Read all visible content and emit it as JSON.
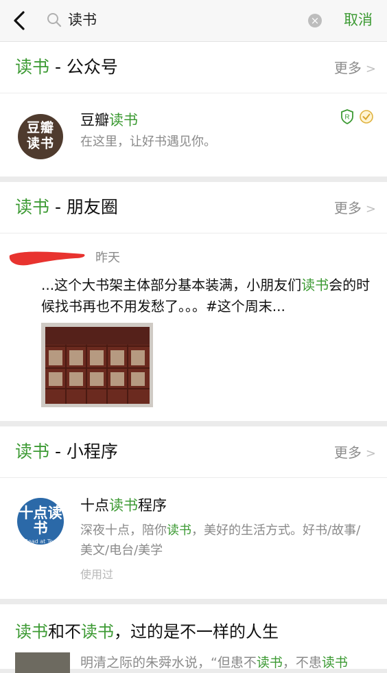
{
  "search": {
    "query": "读书",
    "cancel_label": "取消"
  },
  "sections": {
    "official": {
      "title_hl": "读书",
      "title_rest": " - 公众号",
      "more_label": "更多",
      "account": {
        "avatar_line1": "豆瓣",
        "avatar_line2": "读书",
        "name_pre": "豆瓣",
        "name_hl": "读书",
        "description": "在这里，让好书遇见你。"
      }
    },
    "moments": {
      "title_hl": "读书",
      "title_rest": " - 朋友圈",
      "more_label": "更多",
      "post": {
        "date": "昨天",
        "text_pre": "...这个大书架主体部分基本装满，小朋友们",
        "text_hl": "读书",
        "text_post": "会的时候找书再也不用发愁了。。。#这个周末..."
      }
    },
    "miniprogram": {
      "title_hl": "读书",
      "title_rest": " - 小程序",
      "more_label": "更多",
      "app": {
        "icon_text": "十点读书",
        "icon_sub": "Read at Ten",
        "name_pre": "十点",
        "name_hl": "读书",
        "name_post": "程序",
        "desc_pre": "深夜十点，陪你",
        "desc_hl": "读书",
        "desc_post": "，美好的生活方式。好书/故事/美文/电台/美学",
        "used_label": "使用过"
      }
    },
    "article": {
      "t1": "读书",
      "t2": "和不",
      "t3": "读书",
      "t4": "，过的是不一样的人生",
      "s1": "明清之际的朱舜水说，“但患不",
      "s2": "读书",
      "s3": "，不患",
      "s4": "读书"
    }
  },
  "colors": {
    "accent": "#3c9a33",
    "avatar_douban": "#4f3b2e",
    "app_icon": "#2b69a8"
  }
}
